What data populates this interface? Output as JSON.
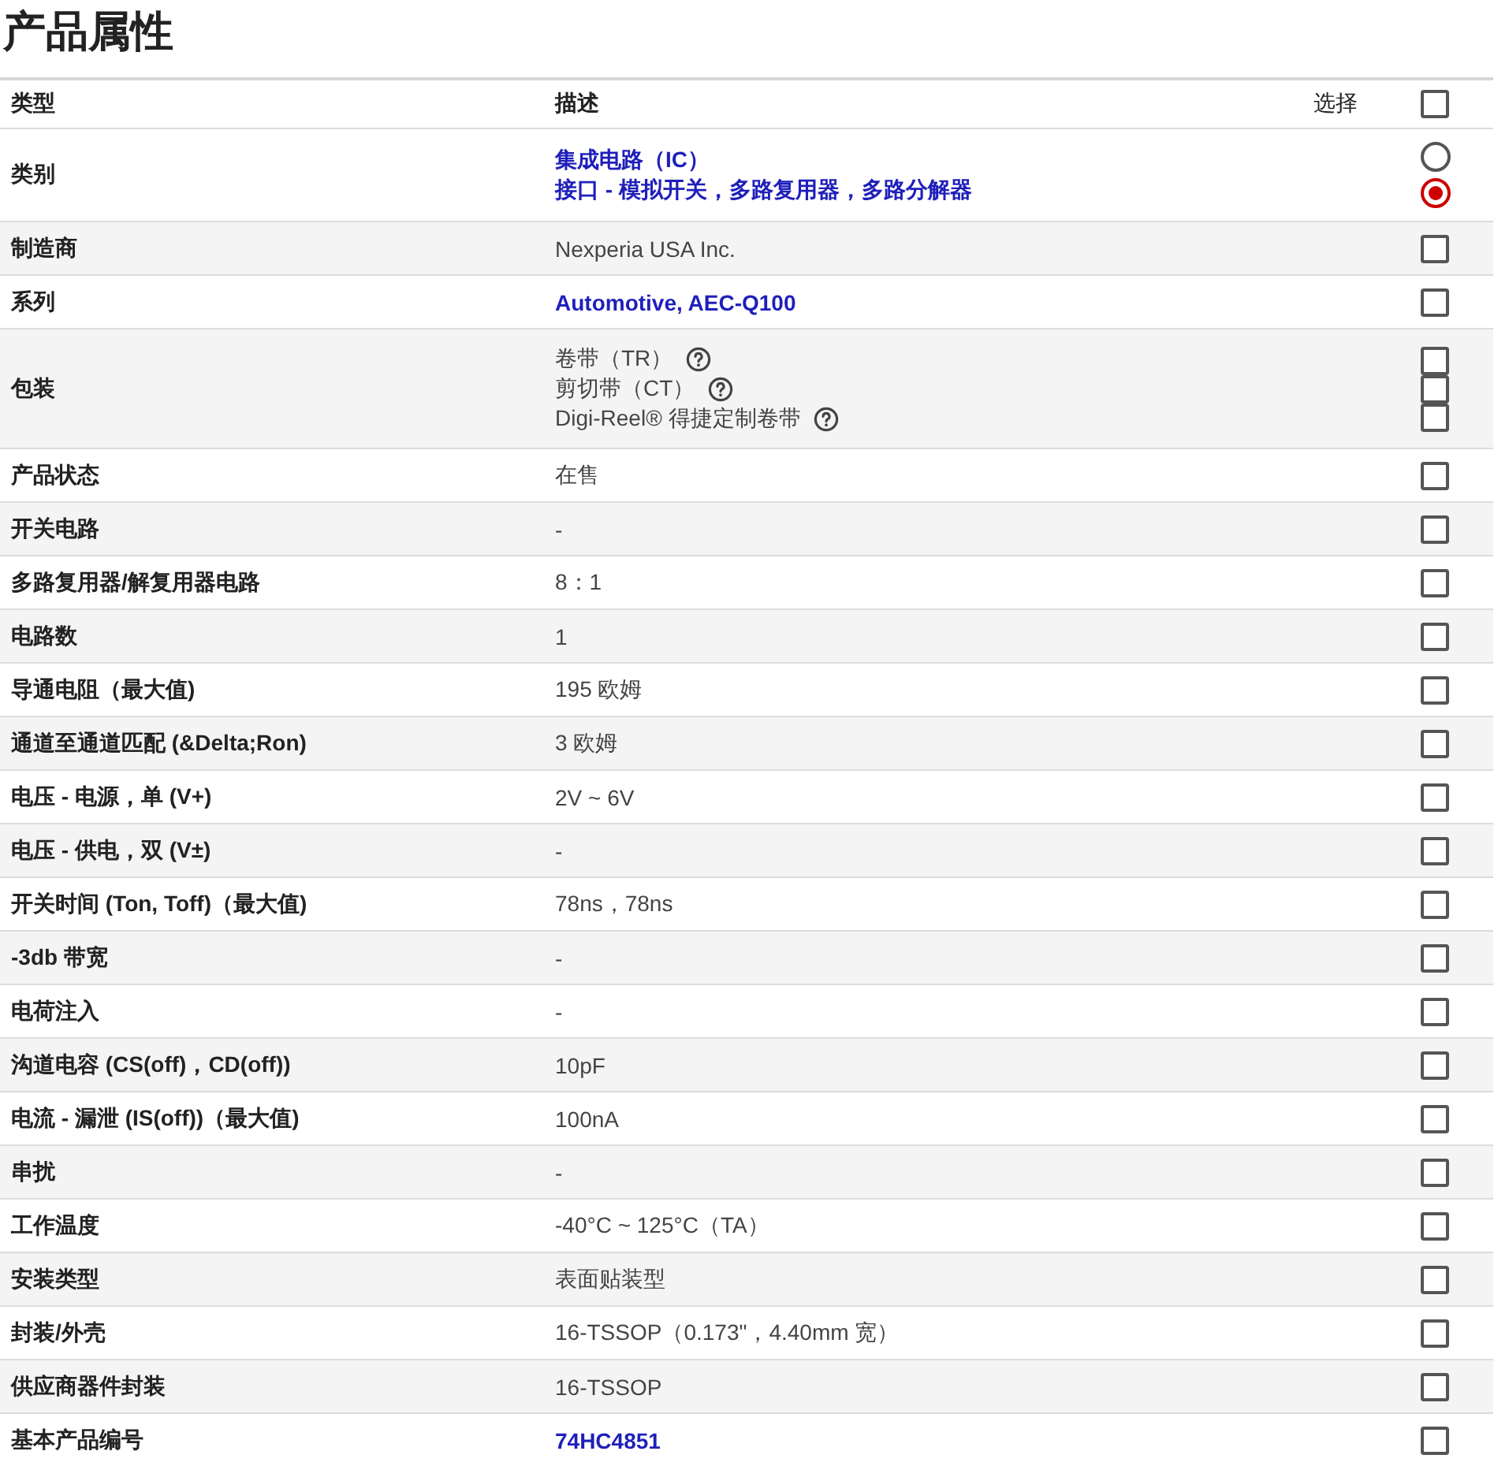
{
  "title": "产品属性",
  "header": {
    "type": "类型",
    "description": "描述",
    "select": "选择",
    "select_all_checked": false
  },
  "rows": [
    {
      "label": "类别",
      "lines": [
        {
          "text": "集成电路（IC）",
          "link": true,
          "help": false
        },
        {
          "text": "接口 - 模拟开关，多路复用器，多路分解器",
          "link": true,
          "help": false
        }
      ],
      "controls": [
        {
          "kind": "radio",
          "selected": false
        },
        {
          "kind": "radio",
          "selected": true
        }
      ]
    },
    {
      "label": "制造商",
      "lines": [
        {
          "text": "Nexperia USA Inc.",
          "link": false,
          "help": false
        }
      ],
      "controls": [
        {
          "kind": "checkbox",
          "checked": false
        }
      ]
    },
    {
      "label": "系列",
      "lines": [
        {
          "text": "Automotive, AEC-Q100",
          "link": true,
          "help": false
        }
      ],
      "controls": [
        {
          "kind": "checkbox",
          "checked": false
        }
      ]
    },
    {
      "label": "包装",
      "lines": [
        {
          "text": "卷带（TR）",
          "link": false,
          "help": true
        },
        {
          "text": "剪切带（CT）",
          "link": false,
          "help": true
        },
        {
          "text": "Digi-Reel® 得捷定制卷带",
          "link": false,
          "help": true
        }
      ],
      "controls": [
        {
          "kind": "checkbox",
          "checked": false
        },
        {
          "kind": "checkbox",
          "checked": false
        },
        {
          "kind": "checkbox",
          "checked": false
        }
      ]
    },
    {
      "label": "产品状态",
      "lines": [
        {
          "text": "在售",
          "link": false,
          "help": false
        }
      ],
      "controls": [
        {
          "kind": "checkbox",
          "checked": false
        }
      ]
    },
    {
      "label": "开关电路",
      "lines": [
        {
          "text": "-",
          "link": false,
          "help": false
        }
      ],
      "controls": [
        {
          "kind": "checkbox",
          "checked": false
        }
      ]
    },
    {
      "label": "多路复用器/解复用器电路",
      "lines": [
        {
          "text": "8：1",
          "link": false,
          "help": false
        }
      ],
      "controls": [
        {
          "kind": "checkbox",
          "checked": false
        }
      ]
    },
    {
      "label": "电路数",
      "lines": [
        {
          "text": "1",
          "link": false,
          "help": false
        }
      ],
      "controls": [
        {
          "kind": "checkbox",
          "checked": false
        }
      ]
    },
    {
      "label": "导通电阻（最大值)",
      "lines": [
        {
          "text": "195 欧姆",
          "link": false,
          "help": false
        }
      ],
      "controls": [
        {
          "kind": "checkbox",
          "checked": false
        }
      ]
    },
    {
      "label": "通道至通道匹配 (&Delta;Ron)",
      "lines": [
        {
          "text": "3 欧姆",
          "link": false,
          "help": false
        }
      ],
      "controls": [
        {
          "kind": "checkbox",
          "checked": false
        }
      ]
    },
    {
      "label": "电压 - 电源，单 (V+)",
      "lines": [
        {
          "text": "2V ~ 6V",
          "link": false,
          "help": false
        }
      ],
      "controls": [
        {
          "kind": "checkbox",
          "checked": false
        }
      ]
    },
    {
      "label": "电压 - 供电，双 (V±)",
      "lines": [
        {
          "text": "-",
          "link": false,
          "help": false
        }
      ],
      "controls": [
        {
          "kind": "checkbox",
          "checked": false
        }
      ]
    },
    {
      "label": "开关时间 (Ton, Toff)（最大值)",
      "lines": [
        {
          "text": "78ns，78ns",
          "link": false,
          "help": false
        }
      ],
      "controls": [
        {
          "kind": "checkbox",
          "checked": false
        }
      ]
    },
    {
      "label": "-3db 带宽",
      "lines": [
        {
          "text": "-",
          "link": false,
          "help": false
        }
      ],
      "controls": [
        {
          "kind": "checkbox",
          "checked": false
        }
      ]
    },
    {
      "label": "电荷注入",
      "lines": [
        {
          "text": "-",
          "link": false,
          "help": false
        }
      ],
      "controls": [
        {
          "kind": "checkbox",
          "checked": false
        }
      ]
    },
    {
      "label": "沟道电容 (CS(off)，CD(off))",
      "lines": [
        {
          "text": "10pF",
          "link": false,
          "help": false
        }
      ],
      "controls": [
        {
          "kind": "checkbox",
          "checked": false
        }
      ]
    },
    {
      "label": "电流 - 漏泄 (IS(off))（最大值)",
      "lines": [
        {
          "text": "100nA",
          "link": false,
          "help": false
        }
      ],
      "controls": [
        {
          "kind": "checkbox",
          "checked": false
        }
      ]
    },
    {
      "label": "串扰",
      "lines": [
        {
          "text": "-",
          "link": false,
          "help": false
        }
      ],
      "controls": [
        {
          "kind": "checkbox",
          "checked": false
        }
      ]
    },
    {
      "label": "工作温度",
      "lines": [
        {
          "text": "-40°C ~ 125°C（TA）",
          "link": false,
          "help": false
        }
      ],
      "controls": [
        {
          "kind": "checkbox",
          "checked": false
        }
      ]
    },
    {
      "label": "安装类型",
      "lines": [
        {
          "text": "表面贴装型",
          "link": false,
          "help": false
        }
      ],
      "controls": [
        {
          "kind": "checkbox",
          "checked": false
        }
      ]
    },
    {
      "label": "封装/外壳",
      "lines": [
        {
          "text": "16-TSSOP（0.173\"，4.40mm 宽）",
          "link": false,
          "help": false
        }
      ],
      "controls": [
        {
          "kind": "checkbox",
          "checked": false
        }
      ]
    },
    {
      "label": "供应商器件封装",
      "lines": [
        {
          "text": "16-TSSOP",
          "link": false,
          "help": false
        }
      ],
      "controls": [
        {
          "kind": "checkbox",
          "checked": false
        }
      ]
    },
    {
      "label": "基本产品编号",
      "lines": [
        {
          "text": "74HC4851",
          "link": true,
          "help": false
        }
      ],
      "controls": [
        {
          "kind": "checkbox",
          "checked": false
        }
      ]
    }
  ]
}
